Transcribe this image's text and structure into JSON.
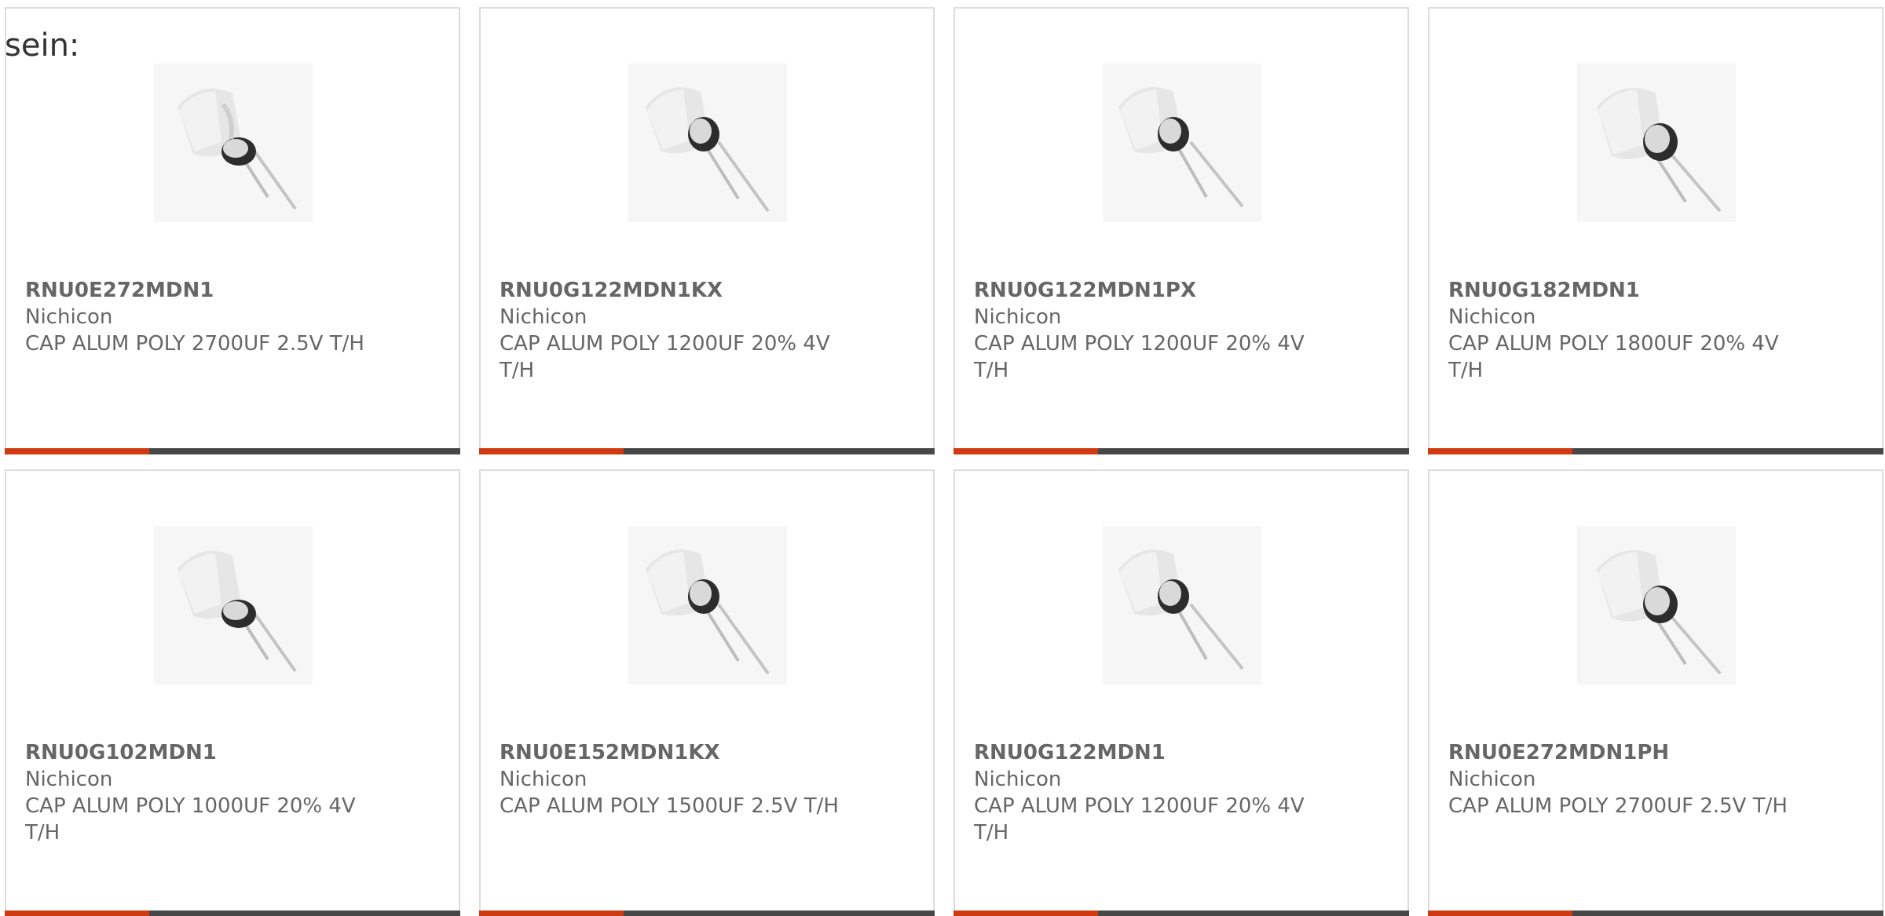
{
  "intro_text": "sein:",
  "colors": {
    "accent": "#cf3a12",
    "bar_dark": "#474747",
    "text": "#666666",
    "border": "#dcdcdc"
  },
  "products": [
    {
      "part_number": "RNU0E272MDN1",
      "manufacturer": "Nichicon",
      "description": "CAP ALUM POLY 2700UF 2.5V T/H",
      "icon": "capacitor-image"
    },
    {
      "part_number": "RNU0G122MDN1KX",
      "manufacturer": "Nichicon",
      "description": "CAP ALUM POLY 1200UF 20% 4V T/H",
      "icon": "capacitor-image"
    },
    {
      "part_number": "RNU0G122MDN1PX",
      "manufacturer": "Nichicon",
      "description": "CAP ALUM POLY 1200UF 20% 4V T/H",
      "icon": "capacitor-image"
    },
    {
      "part_number": "RNU0G182MDN1",
      "manufacturer": "Nichicon",
      "description": "CAP ALUM POLY 1800UF 20% 4V T/H",
      "icon": "capacitor-image"
    },
    {
      "part_number": "RNU0G102MDN1",
      "manufacturer": "Nichicon",
      "description": "CAP ALUM POLY 1000UF 20% 4V T/H",
      "icon": "capacitor-image"
    },
    {
      "part_number": "RNU0E152MDN1KX",
      "manufacturer": "Nichicon",
      "description": "CAP ALUM POLY 1500UF 2.5V T/H",
      "icon": "capacitor-image"
    },
    {
      "part_number": "RNU0G122MDN1",
      "manufacturer": "Nichicon",
      "description": "CAP ALUM POLY 1200UF 20% 4V T/H",
      "icon": "capacitor-image"
    },
    {
      "part_number": "RNU0E272MDN1PH",
      "manufacturer": "Nichicon",
      "description": "CAP ALUM POLY 2700UF 2.5V T/H",
      "icon": "capacitor-image"
    }
  ]
}
